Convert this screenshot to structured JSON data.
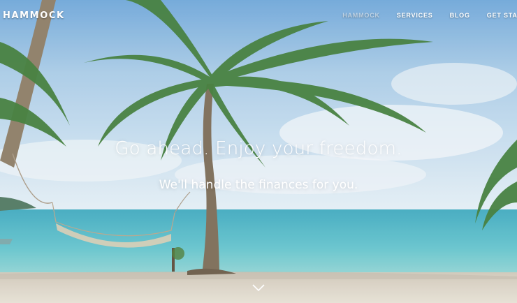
{
  "brand": {
    "logo_text": "HAMMOCK"
  },
  "nav": {
    "items": [
      {
        "label": "HAMMOCK",
        "active": true
      },
      {
        "label": "SERVICES",
        "active": false
      },
      {
        "label": "BLOG",
        "active": false
      },
      {
        "label": "GET STAR",
        "active": false
      }
    ]
  },
  "hero": {
    "headline": "Go ahead. Enjoy your freedom.",
    "subheadline": "We'll handle the finances for you.",
    "scroll_icon": "chevron-down-icon"
  },
  "colors": {
    "sky_top": "#6fa7d6",
    "sky_low": "#dbe9f3",
    "sea": "#4fb7c4",
    "sand": "#d9d2c6",
    "palm": "#3f7a39"
  }
}
